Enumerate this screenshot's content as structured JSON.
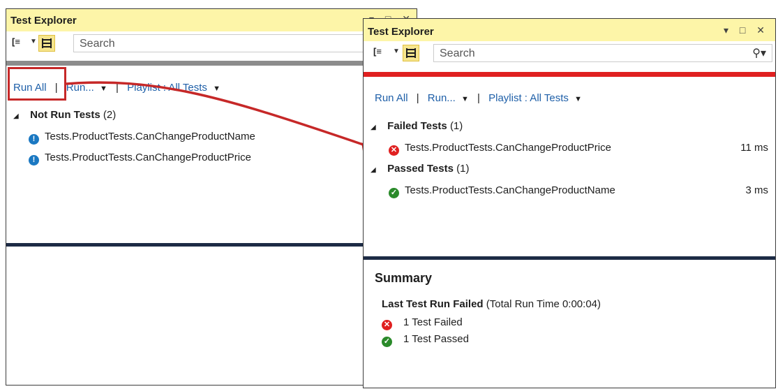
{
  "left_panel": {
    "title": "Test Explorer",
    "search_placeholder": "Search",
    "commands": {
      "run_all": "Run All",
      "run": "Run...",
      "playlist": "Playlist : All Tests"
    },
    "group": {
      "label": "Not Run Tests",
      "count": "(2)"
    },
    "tests": [
      {
        "name": "Tests.ProductTests.CanChangeProductName",
        "status": "not-run"
      },
      {
        "name": "Tests.ProductTests.CanChangeProductPrice",
        "status": "not-run"
      }
    ]
  },
  "right_panel": {
    "title": "Test Explorer",
    "search_placeholder": "Search",
    "commands": {
      "run_all": "Run All",
      "run": "Run...",
      "playlist": "Playlist : All Tests"
    },
    "failed_group": {
      "label": "Failed Tests",
      "count": "(1)",
      "tests": [
        {
          "name": "Tests.ProductTests.CanChangeProductPrice",
          "duration": "11 ms"
        }
      ]
    },
    "passed_group": {
      "label": "Passed Tests",
      "count": "(1)",
      "tests": [
        {
          "name": "Tests.ProductTests.CanChangeProductName",
          "duration": "3 ms"
        }
      ]
    },
    "summary": {
      "heading": "Summary",
      "result_bold": "Last Test Run Failed",
      "result_detail": "(Total Run Time 0:00:04)",
      "failed_line": "1 Test Failed",
      "passed_line": "1 Test Passed"
    }
  },
  "icons": {
    "grouping": "group-by-icon",
    "view": "list-view-icon",
    "search": "search-icon",
    "dropdown": "chevron-down-icon",
    "not_run": "info-circle-icon",
    "failed": "error-x-icon",
    "passed": "check-circle-icon"
  },
  "colors": {
    "titlebar": "#fdf5a8",
    "link": "#1e5fa8",
    "progress_not_run": "#8c8c8c",
    "progress_failed": "#e02020",
    "divider": "#1d2b45",
    "annotation": "#c62828"
  }
}
